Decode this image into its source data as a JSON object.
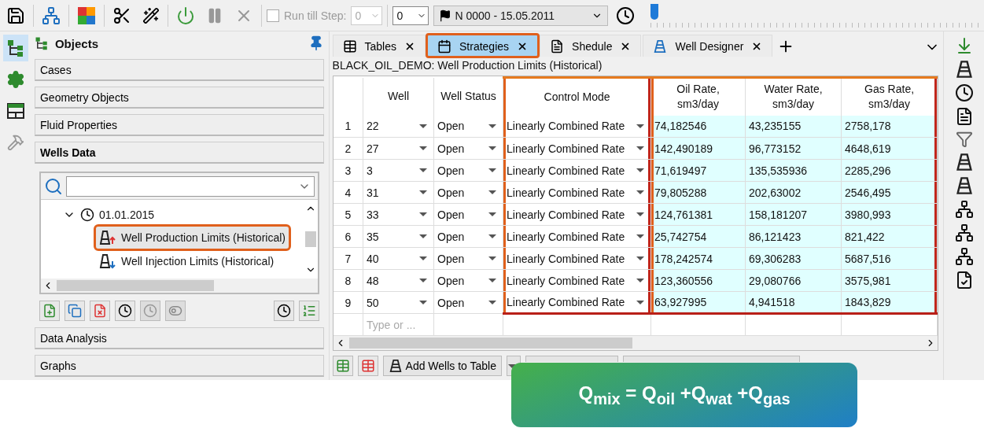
{
  "toolbar": {
    "run_till_step": {
      "label": "Run till Step:",
      "checked": false,
      "value": "0"
    },
    "step": "0",
    "date_combo": "N 0000 - 15.05.2011",
    "timeline": {
      "level": 0
    }
  },
  "side_tabs": [
    {
      "kind": "tree",
      "selected": true
    },
    {
      "kind": "gear",
      "selected": false
    },
    {
      "kind": "layout",
      "selected": false
    },
    {
      "kind": "hammer",
      "selected": false
    }
  ],
  "panel": {
    "title": "Objects",
    "sections_top": [
      {
        "label": "Cases",
        "expanded": false
      },
      {
        "label": "Geometry Objects",
        "expanded": false
      },
      {
        "label": "Fluid Properties",
        "expanded": false
      },
      {
        "label": "Wells Data",
        "expanded": true
      }
    ],
    "tree": {
      "nodes": [
        {
          "label": "01.01.2015",
          "expanded": true,
          "children": [
            {
              "label": "Well Production Limits (Historical)",
              "kind": "production",
              "selected": true,
              "highlighted": true
            },
            {
              "label": "Well Injection Limits (Historical)",
              "kind": "injection",
              "selected": false,
              "highlighted": false
            }
          ]
        }
      ]
    },
    "sections_bottom": [
      {
        "label": "Data Analysis",
        "expanded": false
      },
      {
        "label": "Graphs",
        "expanded": false
      }
    ]
  },
  "tabs": [
    {
      "label": "Tables",
      "kind": "table",
      "selected": false,
      "highlighted": false
    },
    {
      "label": "Strategies",
      "kind": "calendar",
      "selected": true,
      "highlighted": true
    },
    {
      "label": "Shedule",
      "kind": "document",
      "selected": false,
      "highlighted": false
    },
    {
      "label": "Well Designer",
      "kind": "derrick",
      "selected": false,
      "highlighted": false
    }
  ],
  "breadcrumb": "BLACK_OIL_DEMO: Well Production Limits (Historical)",
  "table": {
    "columns": [
      {
        "label": "Well",
        "kind": "dropdown",
        "tinted": false,
        "highlighted": false
      },
      {
        "label": "Well Status",
        "kind": "dropdown",
        "tinted": false,
        "highlighted": false
      },
      {
        "label": "Control Mode",
        "kind": "dropdown",
        "tinted": false,
        "highlighted": true
      },
      {
        "label": "Oil Rate,\nsm3/day",
        "kind": "number",
        "tinted": true,
        "highlighted": true
      },
      {
        "label": "Water Rate,\nsm3/day",
        "kind": "number",
        "tinted": true,
        "highlighted": true
      },
      {
        "label": "Gas Rate,\nsm3/day",
        "kind": "number",
        "tinted": true,
        "highlighted": true
      }
    ],
    "rows": [
      {
        "index": "1",
        "cells": [
          "22",
          "Open",
          "Linearly Combined Rate",
          "74,182546",
          "43,235155",
          "2758,178"
        ]
      },
      {
        "index": "2",
        "cells": [
          "27",
          "Open",
          "Linearly Combined Rate",
          "142,490189",
          "96,773152",
          "4648,619"
        ]
      },
      {
        "index": "3",
        "cells": [
          "3",
          "Open",
          "Linearly Combined Rate",
          "71,619497",
          "135,535936",
          "2285,296"
        ]
      },
      {
        "index": "4",
        "cells": [
          "31",
          "Open",
          "Linearly Combined Rate",
          "79,805288",
          "202,63002",
          "2546,495"
        ]
      },
      {
        "index": "5",
        "cells": [
          "33",
          "Open",
          "Linearly Combined Rate",
          "124,761381",
          "158,181207",
          "3980,993"
        ]
      },
      {
        "index": "6",
        "cells": [
          "35",
          "Open",
          "Linearly Combined Rate",
          "25,742754",
          "86,121423",
          "821,422"
        ]
      },
      {
        "index": "7",
        "cells": [
          "40",
          "Open",
          "Linearly Combined Rate",
          "178,242574",
          "69,306283",
          "5687,516"
        ]
      },
      {
        "index": "8",
        "cells": [
          "48",
          "Open",
          "Linearly Combined Rate",
          "123,360556",
          "29,080766",
          "3575,981"
        ]
      },
      {
        "index": "9",
        "cells": [
          "50",
          "Open",
          "Linearly Combined Rate",
          "63,927995",
          "4,941518",
          "1843,829"
        ]
      }
    ],
    "new_row_placeholder": "Type or ..."
  },
  "bottom_toolbar": {
    "add_wells": "Add Wells to Table"
  },
  "callout": "Q$_{mix}$ = Q$_{oil}$ +Q$_{wat}$ +Q$_{gas}$"
}
